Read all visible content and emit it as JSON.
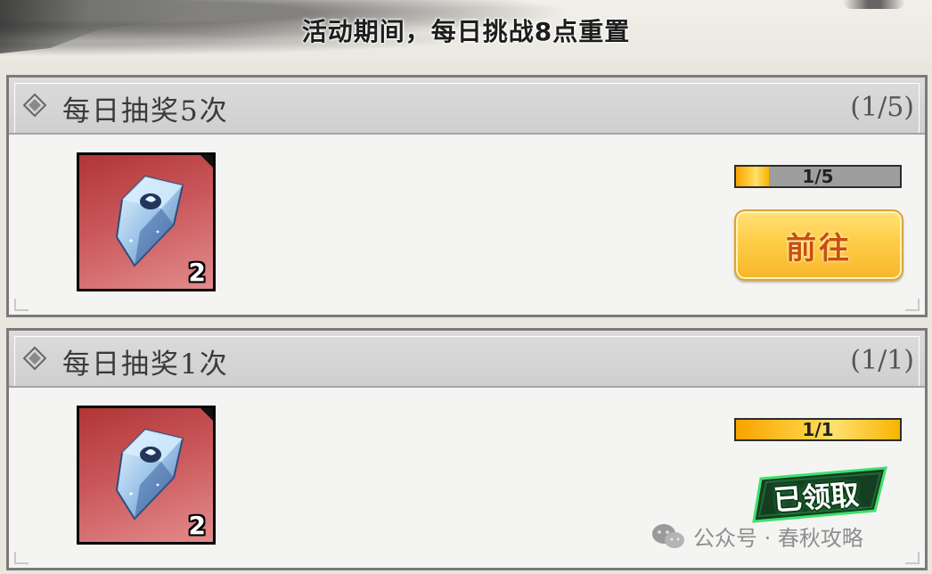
{
  "banner": {
    "text": "活动期间，每日挑战8点重置"
  },
  "tasks": [
    {
      "title": "每日抽奖5次",
      "count": "(1/5)",
      "reward": {
        "icon": "crystal-gem-icon",
        "quantity": "2"
      },
      "progress": {
        "text": "1/5",
        "current": 1,
        "total": 5
      },
      "action": {
        "type": "goto",
        "label": "前往"
      }
    },
    {
      "title": "每日抽奖1次",
      "count": "(1/1)",
      "reward": {
        "icon": "crystal-gem-icon",
        "quantity": "2"
      },
      "progress": {
        "text": "1/1",
        "current": 1,
        "total": 1
      },
      "action": {
        "type": "claimed",
        "label": "已领取"
      }
    }
  ],
  "watermark": {
    "icon": "wechat-icon",
    "text": "公众号 · 春秋攻略"
  },
  "colors": {
    "card_header": "#d4d4d4",
    "tile_red": "#c04648",
    "progress_fill": "#ffc830",
    "goto_button": "#ffcf4a",
    "goto_text": "#c8500e",
    "claimed_glow": "#2fd05a"
  }
}
